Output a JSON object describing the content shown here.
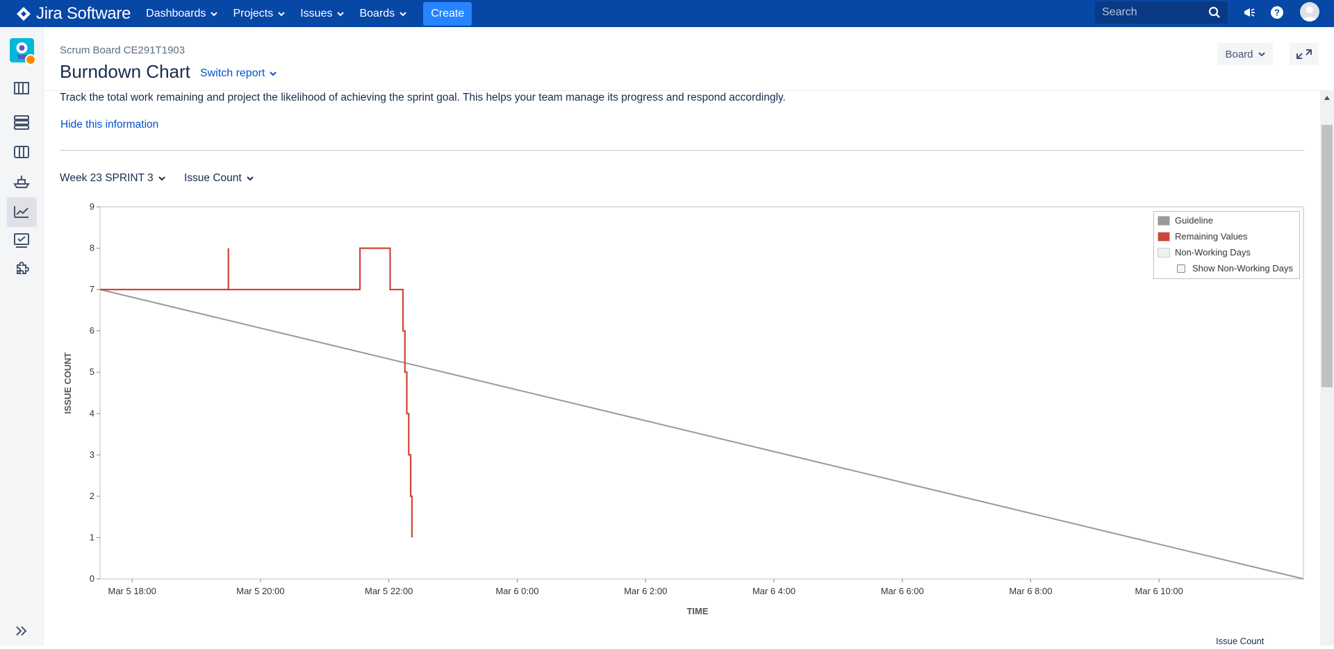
{
  "topnav": {
    "product": "Jira Software",
    "items": [
      {
        "label": "Dashboards"
      },
      {
        "label": "Projects"
      },
      {
        "label": "Issues"
      },
      {
        "label": "Boards"
      }
    ],
    "create_label": "Create",
    "search_placeholder": "Search"
  },
  "header": {
    "breadcrumb": "Scrum Board CE291T1903",
    "title": "Burndown Chart",
    "switch_report": "Switch report",
    "board_button": "Board"
  },
  "info": {
    "description": "Track the total work remaining and project the likelihood of achieving the sprint goal. This helps your team manage its progress and respond accordingly.",
    "hide_link": "Hide this information"
  },
  "controls": {
    "sprint_select": "Week 23 SPRINT 3",
    "statistic_select": "Issue Count"
  },
  "legend": {
    "guideline": "Guideline",
    "remaining": "Remaining Values",
    "non_working": "Non-Working Days",
    "show_non_working": "Show Non-Working Days"
  },
  "colors": {
    "nav": "#0747a6",
    "guideline": "#999999",
    "remaining": "#d04437",
    "link": "#0052cc"
  },
  "chart_data": {
    "type": "line",
    "xlabel": "TIME",
    "ylabel": "ISSUE COUNT",
    "ylim": [
      0,
      9
    ],
    "yticks": [
      0,
      1,
      2,
      3,
      4,
      5,
      6,
      7,
      8,
      9
    ],
    "x_ticks": [
      "Mar 5 18:00",
      "Mar 5 20:00",
      "Mar 5 22:00",
      "Mar 6 0:00",
      "Mar 6 2:00",
      "Mar 6 4:00",
      "Mar 6 6:00",
      "Mar 6 8:00",
      "Mar 6 10:00"
    ],
    "x_range_hours": [
      17.5,
      36.25
    ],
    "x_unit": "hours since Mar 5 0:00",
    "series": [
      {
        "name": "Guideline",
        "points": [
          [
            17.5,
            7
          ],
          [
            36.25,
            0
          ]
        ]
      },
      {
        "name": "Remaining Values",
        "step": true,
        "points": [
          [
            17.5,
            7
          ],
          [
            19.5,
            7
          ],
          [
            19.5,
            8
          ],
          [
            19.5,
            7
          ],
          [
            21.55,
            7
          ],
          [
            21.55,
            8
          ],
          [
            22.02,
            8
          ],
          [
            22.02,
            7
          ],
          [
            22.22,
            7
          ],
          [
            22.22,
            6
          ],
          [
            22.25,
            6
          ],
          [
            22.25,
            5
          ],
          [
            22.28,
            5
          ],
          [
            22.28,
            4
          ],
          [
            22.31,
            4
          ],
          [
            22.31,
            3
          ],
          [
            22.34,
            3
          ],
          [
            22.34,
            2
          ],
          [
            22.36,
            2
          ],
          [
            22.36,
            1
          ]
        ]
      }
    ],
    "legend": "top-right",
    "grid": false
  },
  "footer": {
    "issue_count_label": "Issue Count"
  }
}
